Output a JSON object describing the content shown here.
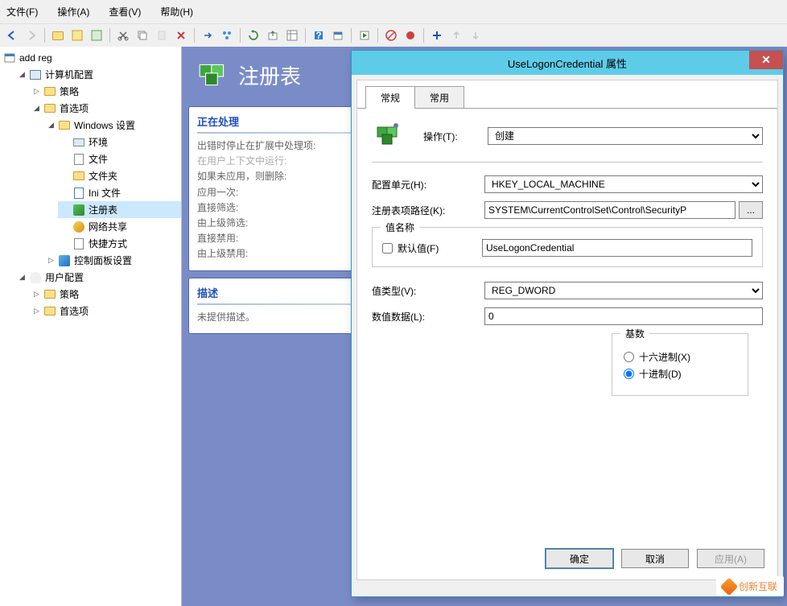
{
  "menubar": {
    "file": "文件(F)",
    "action": "操作(A)",
    "view": "查看(V)",
    "help": "帮助(H)"
  },
  "tree": {
    "root": "add reg",
    "computer_cfg": "计算机配置",
    "policy": "策略",
    "prefs": "首选项",
    "windows_settings": "Windows 设置",
    "env": "环境",
    "files": "文件",
    "folders": "文件夹",
    "ini": "Ini 文件",
    "registry": "注册表",
    "netshare": "网络共享",
    "shortcut": "快捷方式",
    "ctrl_panel": "控制面板设置",
    "user_cfg": "用户配置",
    "user_policy": "策略",
    "user_prefs": "首选项"
  },
  "middle": {
    "title": "注册表",
    "processing": "正在处理",
    "p1": "出错时停止在扩展中处理项:",
    "p2": "在用户上下文中运行:",
    "p3": "如果未应用，则删除:",
    "p4": "应用一次:",
    "p5": "直接筛选:",
    "p6": "由上级筛选:",
    "p7": "直接禁用:",
    "p8": "由上级禁用:",
    "desc_title": "描述",
    "desc_body": "未提供描述。"
  },
  "dialog": {
    "title": "UseLogonCredential 属性",
    "tab_general": "常规",
    "tab_common": "常用",
    "action_label": "操作(T):",
    "action_value": "创建",
    "hive_label": "配置单元(H):",
    "hive_value": "HKEY_LOCAL_MACHINE",
    "keypath_label": "注册表项路径(K):",
    "keypath_value": "SYSTEM\\CurrentControlSet\\Control\\SecurityP",
    "browse": "...",
    "valuename_legend": "值名称",
    "default_chk": "默认值(F)",
    "valuename_value": "UseLogonCredential",
    "valuetype_label": "值类型(V):",
    "valuetype_value": "REG_DWORD",
    "valuedata_label": "数值数据(L):",
    "valuedata_value": "0",
    "radix_legend": "基数",
    "radix_hex": "十六进制(X)",
    "radix_dec": "十进制(D)",
    "ok": "确定",
    "cancel": "取消",
    "apply": "应用(A)"
  },
  "watermark": "创新互联"
}
